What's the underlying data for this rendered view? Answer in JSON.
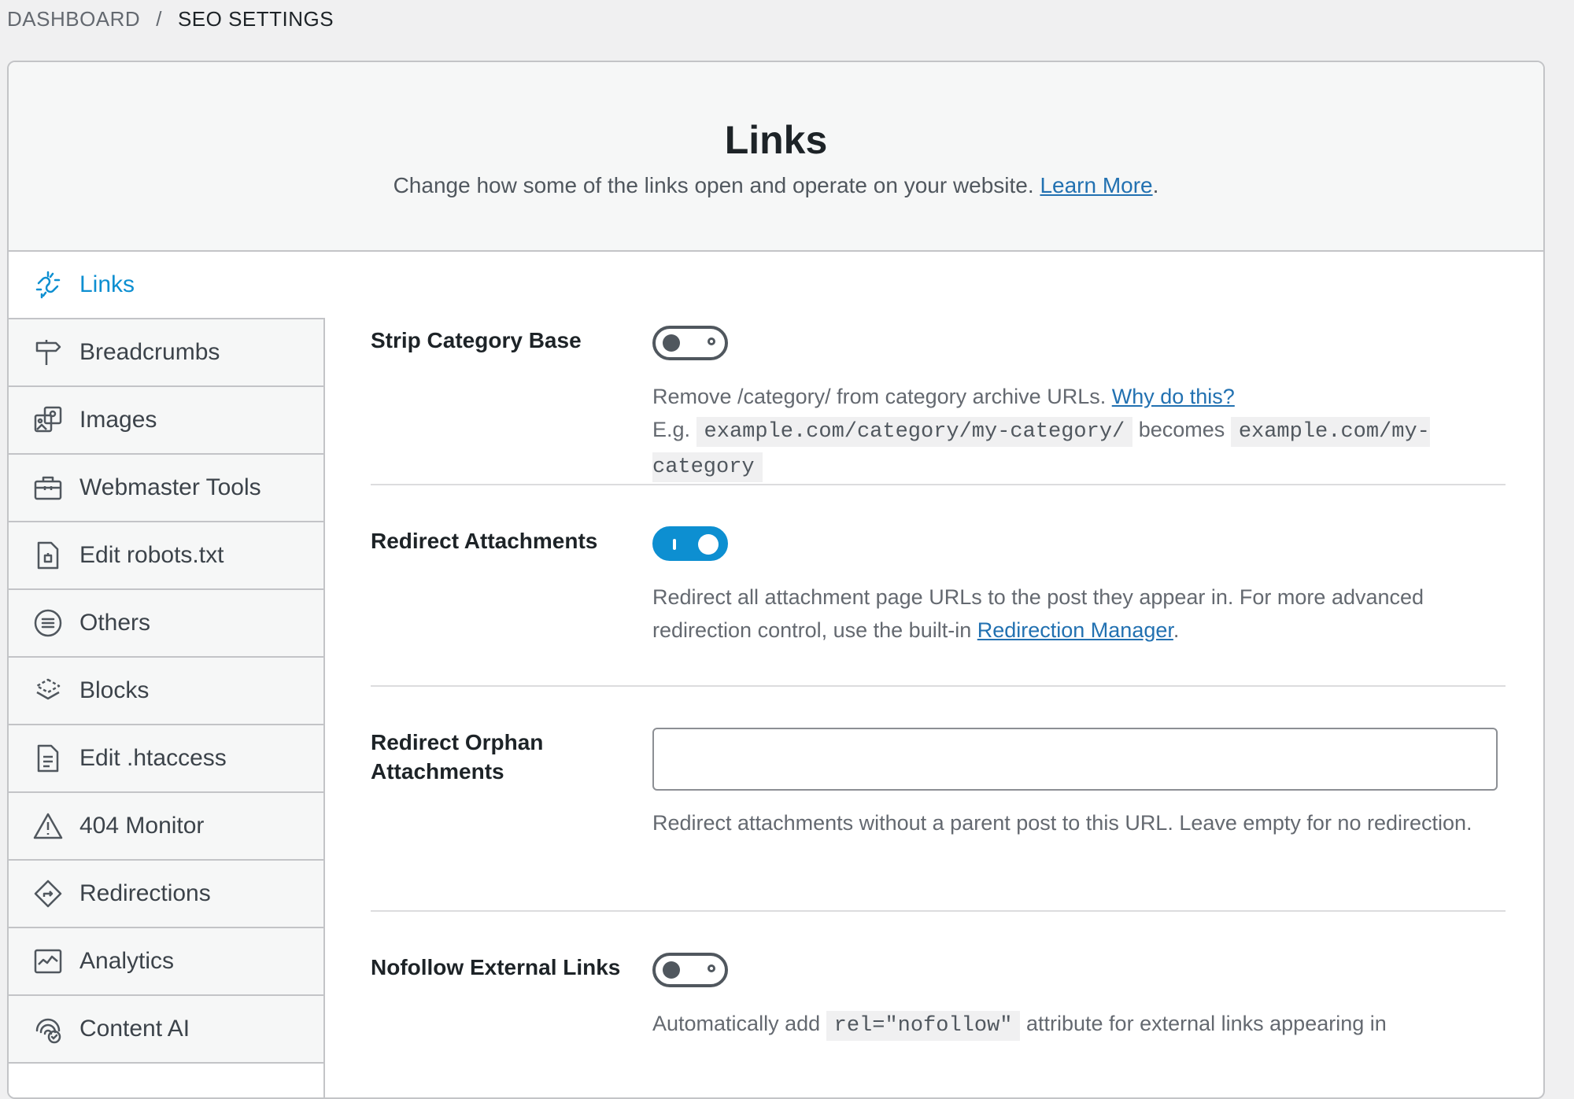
{
  "breadcrumb": {
    "parent": "DASHBOARD",
    "separator": "/",
    "current": "SEO SETTINGS"
  },
  "header": {
    "title": "Links",
    "description": "Change how some of the links open and operate on your website.",
    "learn_more": "Learn More",
    "period": "."
  },
  "sidebar": {
    "items": [
      {
        "label": "Links",
        "icon": "broken-link-icon",
        "active": true
      },
      {
        "label": "Breadcrumbs",
        "icon": "signpost-icon"
      },
      {
        "label": "Images",
        "icon": "images-icon"
      },
      {
        "label": "Webmaster Tools",
        "icon": "toolbox-icon"
      },
      {
        "label": "Edit robots.txt",
        "icon": "robots-file-icon"
      },
      {
        "label": "Others",
        "icon": "list-circle-icon"
      },
      {
        "label": "Blocks",
        "icon": "blocks-icon"
      },
      {
        "label": "Edit .htaccess",
        "icon": "document-icon"
      },
      {
        "label": "404 Monitor",
        "icon": "warning-icon"
      },
      {
        "label": "Redirections",
        "icon": "redirect-diamond-icon"
      },
      {
        "label": "Analytics",
        "icon": "analytics-icon"
      },
      {
        "label": "Content AI",
        "icon": "content-ai-icon"
      }
    ]
  },
  "settings": {
    "strip_category": {
      "label": "Strip Category Base",
      "enabled": false,
      "help_text": "Remove /category/ from category archive URLs.",
      "why_link": "Why do this?",
      "example_prefix": "E.g.",
      "example_from": "example.com/category/my-category/",
      "example_mid": "becomes",
      "example_to": "example.com/my-category"
    },
    "redirect_attachments": {
      "label": "Redirect Attachments",
      "enabled": true,
      "help_text": "Redirect all attachment page URLs to the post they appear in. For more advanced redirection control, use the built-in",
      "manager_link": "Redirection Manager",
      "period": "."
    },
    "redirect_orphan": {
      "label": "Redirect Orphan Attachments",
      "value": "",
      "help_text": "Redirect attachments without a parent post to this URL. Leave empty for no redirection."
    },
    "nofollow_external": {
      "label": "Nofollow External Links",
      "enabled": false,
      "help_prefix": "Automatically add",
      "help_code": "rel=\"nofollow\"",
      "help_suffix": "attribute for external links appearing in"
    }
  },
  "colors": {
    "accent": "#0d8fd1",
    "link": "#2271b1",
    "border": "#c3c4c7"
  }
}
